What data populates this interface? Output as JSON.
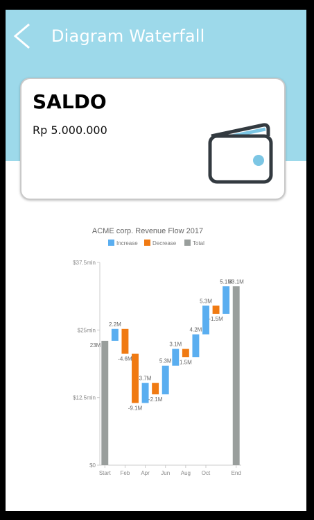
{
  "header": {
    "title": "Diagram Waterfall",
    "back_icon": "chevron-left-icon"
  },
  "card": {
    "title": "SALDO",
    "amount": "Rp 5.000.000",
    "icon": "wallet-icon"
  },
  "colors": {
    "header_bg": "#9dd9ea",
    "increase": "#5aaef0",
    "decrease": "#f07a12",
    "total": "#999e9c"
  },
  "chart_data": {
    "type": "bar",
    "subtype": "waterfall",
    "title": "ACME corp. Revenue Flow 2017",
    "legend": [
      "Increase",
      "Decrease",
      "Total"
    ],
    "legend_position": "top",
    "y_ticks": [
      "$0",
      "$12.5mln",
      "$25mln",
      "$37.5mln"
    ],
    "ylim": [
      0,
      37.5
    ],
    "x_tick_labels": [
      "Start",
      "Feb",
      "Apr",
      "Jun",
      "Aug",
      "Oct",
      "End"
    ],
    "steps": [
      {
        "kind": "total",
        "start": 0,
        "end": 23,
        "label": "23M"
      },
      {
        "kind": "increase",
        "start": 23,
        "end": 25.2,
        "label": "2.2M"
      },
      {
        "kind": "decrease",
        "start": 25.2,
        "end": 20.6,
        "label": "-4.6M"
      },
      {
        "kind": "decrease",
        "start": 20.6,
        "end": 11.5,
        "label": "-9.1M"
      },
      {
        "kind": "increase",
        "start": 11.5,
        "end": 15.2,
        "label": "3.7M"
      },
      {
        "kind": "decrease",
        "start": 15.2,
        "end": 13.1,
        "label": "-2.1M"
      },
      {
        "kind": "increase",
        "start": 13.1,
        "end": 18.4,
        "label": "5.3M"
      },
      {
        "kind": "increase",
        "start": 18.4,
        "end": 21.5,
        "label": "3.1M"
      },
      {
        "kind": "decrease",
        "start": 21.5,
        "end": 20.0,
        "label": "1.5M"
      },
      {
        "kind": "increase",
        "start": 20.0,
        "end": 24.2,
        "label": "4.2M"
      },
      {
        "kind": "increase",
        "start": 24.2,
        "end": 29.5,
        "label": "5.3M"
      },
      {
        "kind": "decrease",
        "start": 29.5,
        "end": 28.0,
        "label": "-1.5M"
      },
      {
        "kind": "increase",
        "start": 28.0,
        "end": 33.1,
        "label": "5.1M"
      },
      {
        "kind": "total",
        "start": 0,
        "end": 33.1,
        "label": "33.1M"
      }
    ]
  }
}
